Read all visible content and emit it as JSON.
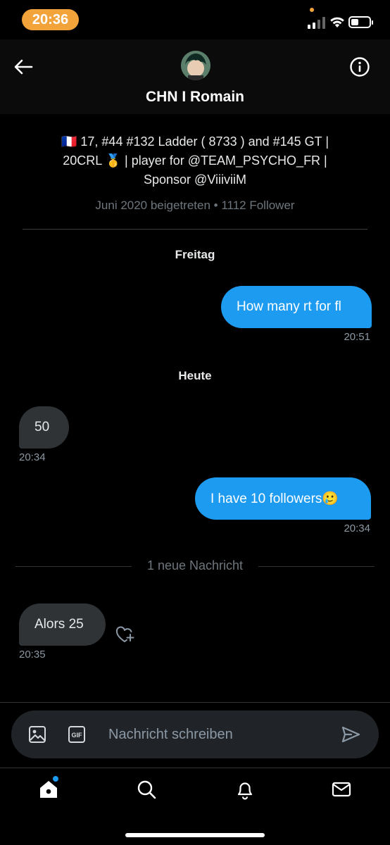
{
  "status_bar": {
    "time": "20:36"
  },
  "header": {
    "name": "CHN I Romain"
  },
  "profile": {
    "bio_line1": "🇫🇷 17, #44 #132 Ladder ( 8733 ) and #145 GT |",
    "bio_line2": "20CRL 🥇 | player for @TEAM_PSYCHO_FR |",
    "bio_line3": "Sponsor @ViiiviiM",
    "joined": "Juni 2020 beigetreten • 1112 Follower"
  },
  "conversation": {
    "day1": "Freitag",
    "msg1": {
      "text": "How many rt for fl",
      "time": "20:51"
    },
    "day2": "Heute",
    "msg2": {
      "text": "50",
      "time": "20:34"
    },
    "msg3": {
      "text": "I have 10 followers🥲",
      "time": "20:34"
    },
    "new_divider": "1 neue Nachricht",
    "msg4": {
      "text": "Alors 25",
      "time": "20:35"
    }
  },
  "composer": {
    "placeholder": "Nachricht schreiben",
    "gif_label": "GIF"
  },
  "icons": {
    "back": "arrow-left-icon",
    "info": "info-icon",
    "image": "image-icon",
    "gif": "gif-icon",
    "send": "send-icon",
    "reaction": "heart-plus-icon",
    "home": "home-icon",
    "search": "search-icon",
    "notifications": "bell-icon",
    "messages": "envelope-icon"
  },
  "colors": {
    "accent": "#1d9bf0",
    "status_pill": "#f2a33a",
    "received_bubble": "#2f3336"
  }
}
